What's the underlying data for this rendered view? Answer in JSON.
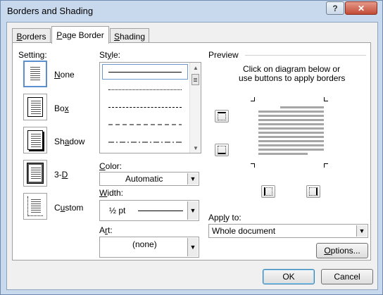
{
  "window": {
    "title": "Borders and Shading",
    "help_label": "?",
    "close_label": "✕"
  },
  "tabs": [
    {
      "label": "Borders",
      "mnemonic": "B",
      "rest": "orders"
    },
    {
      "label": "Page Border",
      "mnemonic": "P",
      "rest": "age Border"
    },
    {
      "label": "Shading",
      "mnemonic": "S",
      "rest": "hading"
    }
  ],
  "setting": {
    "label": "Setting:",
    "options": [
      {
        "label": "None",
        "mnemonic": "N",
        "rest": "one",
        "selected": true
      },
      {
        "label": "Box",
        "pre": "Bo",
        "mnemonic": "x",
        "rest": ""
      },
      {
        "label": "Shadow",
        "pre": "Sh",
        "mnemonic": "a",
        "rest": "dow"
      },
      {
        "label": "3-D",
        "pre": "3-",
        "mnemonic": "D",
        "rest": ""
      },
      {
        "label": "Custom",
        "pre": "C",
        "mnemonic": "u",
        "rest": "stom"
      }
    ]
  },
  "style": {
    "label": "Style:",
    "mnemonic": "y",
    "pre": "St",
    "rest": "le:",
    "options": [
      "solid",
      "dotted",
      "dashed-small",
      "dashed-large",
      "dash-dot"
    ]
  },
  "color": {
    "label": "Color:",
    "pre": "",
    "mnemonic": "C",
    "rest": "olor:",
    "value": "Automatic"
  },
  "width": {
    "label": "Width:",
    "mnemonic": "W",
    "rest": "idth:",
    "value": "½ pt"
  },
  "art": {
    "label": "Art:",
    "pre": "A",
    "mnemonic": "r",
    "rest": "t:",
    "value": "(none)"
  },
  "preview": {
    "label": "Preview",
    "instruction_line1": "Click on diagram below or",
    "instruction_line2": "use buttons to apply borders"
  },
  "apply_to": {
    "label": "Apply to:",
    "pre": "App",
    "mnemonic": "l",
    "rest": "y to:",
    "value": "Whole document"
  },
  "buttons": {
    "options": {
      "label": "Options...",
      "mnemonic": "O",
      "rest": "ptions..."
    },
    "ok": "OK",
    "cancel": "Cancel"
  },
  "colors": {
    "frame": "#c9d9ed",
    "close": "#c14b36",
    "selection": "#5b8fcf",
    "preview_text": "#a6a6a6"
  }
}
